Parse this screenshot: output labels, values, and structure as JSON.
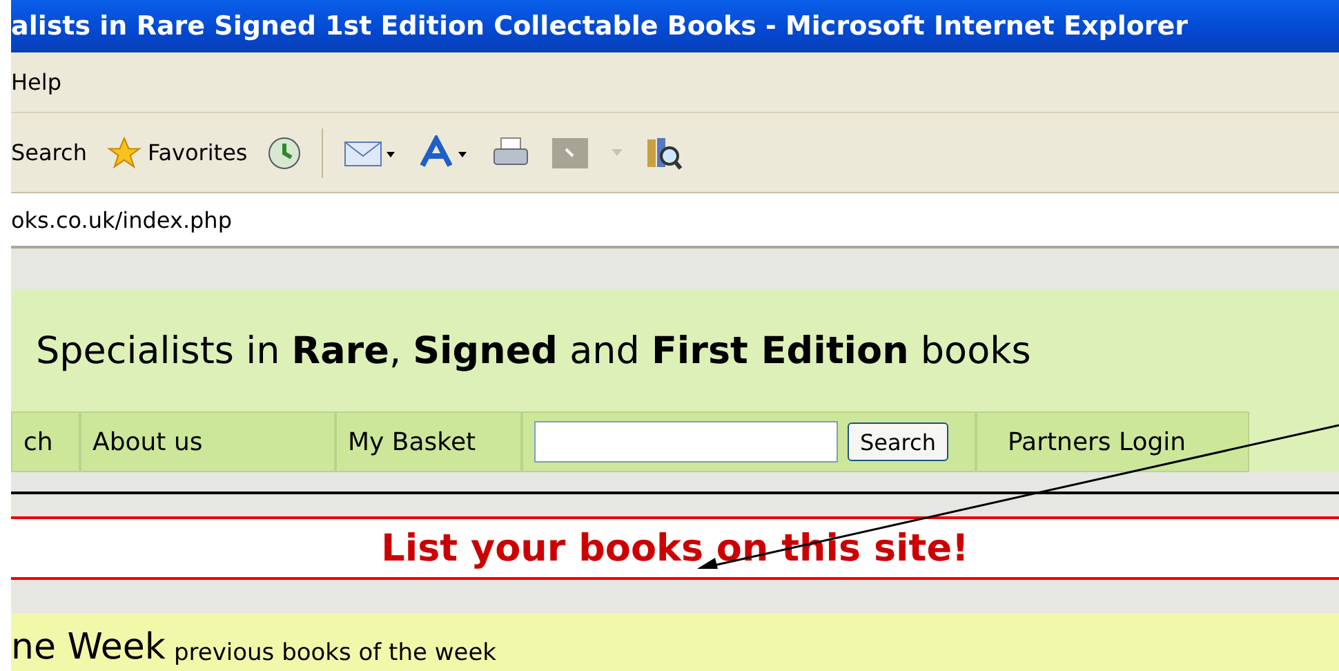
{
  "window": {
    "title": "alists in Rare Signed 1st Edition Collectable Books - Microsoft Internet Explorer"
  },
  "menu": [
    "Help"
  ],
  "toolbar": [
    {
      "kind": "search",
      "label": "Search"
    },
    {
      "kind": "favorites",
      "label": "Favorites"
    }
  ],
  "address": "oks.co.uk/index.php",
  "page": {
    "tagline": "Specialists in **Rare**, **Signed** and **First Edition** books",
    "nav": [
      {
        "kind": "link",
        "label": "ch"
      },
      {
        "kind": "link",
        "label": "About us"
      },
      {
        "kind": "link",
        "label": "My Basket"
      },
      {
        "kind": "search",
        "button": "Search"
      },
      {
        "kind": "link",
        "label": "Partners Login"
      }
    ],
    "banner": "List your books on this site!",
    "section_heading": "ne Week",
    "section_link": "previous books of the week"
  }
}
